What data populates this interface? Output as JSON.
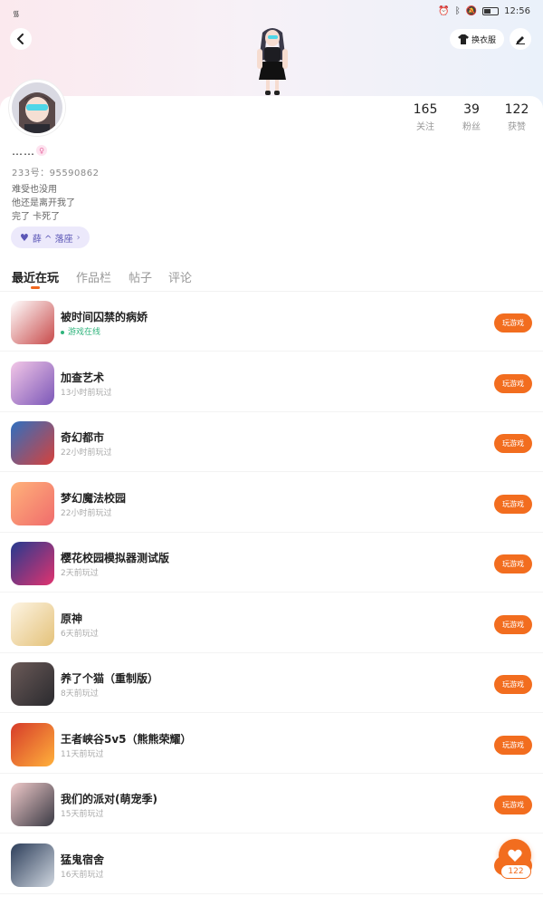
{
  "status_bar": {
    "time": "12:56",
    "left_indicator": "᯾"
  },
  "header": {
    "back_icon": "chevron-left-icon",
    "dressup_label": "换衣服",
    "edit_icon": "pencil-icon"
  },
  "profile": {
    "nickname": "……",
    "uid_label": "233号：",
    "uid": "95590862",
    "bio": [
      "难受也没用",
      "他还是离开我了",
      "完了 卡死了"
    ],
    "medal_label": "薛 ^ 落座",
    "stats": [
      {
        "value": "165",
        "label": "关注"
      },
      {
        "value": "39",
        "label": "粉丝"
      },
      {
        "value": "122",
        "label": "获赞"
      }
    ]
  },
  "tabs": [
    "最近在玩",
    "作品栏",
    "帖子",
    "评论"
  ],
  "games": [
    {
      "name": "被时间囚禁的病娇",
      "time": "游戏在线",
      "online": true,
      "colors": [
        "#ffffff",
        "#c84a4a"
      ]
    },
    {
      "name": "加查艺术",
      "time": "13小时前玩过",
      "online": false,
      "colors": [
        "#f3c7e7",
        "#7b57b8"
      ]
    },
    {
      "name": "奇幻都市",
      "time": "22小时前玩过",
      "online": false,
      "colors": [
        "#2f6fc0",
        "#d7413b"
      ]
    },
    {
      "name": "梦幻魔法校园",
      "time": "22小时前玩过",
      "online": false,
      "colors": [
        "#ffb27a",
        "#f06c6c"
      ]
    },
    {
      "name": "樱花校园模拟器测试版",
      "time": "2天前玩过",
      "online": false,
      "colors": [
        "#253a8f",
        "#e1336f"
      ]
    },
    {
      "name": "原神",
      "time": "6天前玩过",
      "online": false,
      "colors": [
        "#fdf4e3",
        "#e4c27a"
      ]
    },
    {
      "name": "养了个猫（重制版）",
      "time": "8天前玩过",
      "online": false,
      "colors": [
        "#6b5a58",
        "#2a2a2e"
      ]
    },
    {
      "name": "王者峡谷5v5（熊熊荣耀）",
      "time": "11天前玩过",
      "online": false,
      "colors": [
        "#d63b2a",
        "#ffb13b"
      ]
    },
    {
      "name": "我们的派对(萌宠季)",
      "time": "15天前玩过",
      "online": false,
      "colors": [
        "#efc9c9",
        "#3a3a44"
      ]
    },
    {
      "name": "猛鬼宿舍",
      "time": "16天前玩过",
      "online": false,
      "colors": [
        "#2d3e5a",
        "#cfd6df"
      ]
    }
  ],
  "play_button_label": "玩游戏",
  "like_fab": {
    "count": "122",
    "icon": "heart-icon"
  },
  "colors": {
    "accent": "#f26d1f",
    "online": "#2fb47c",
    "medal_bg": "#ece9fb"
  }
}
